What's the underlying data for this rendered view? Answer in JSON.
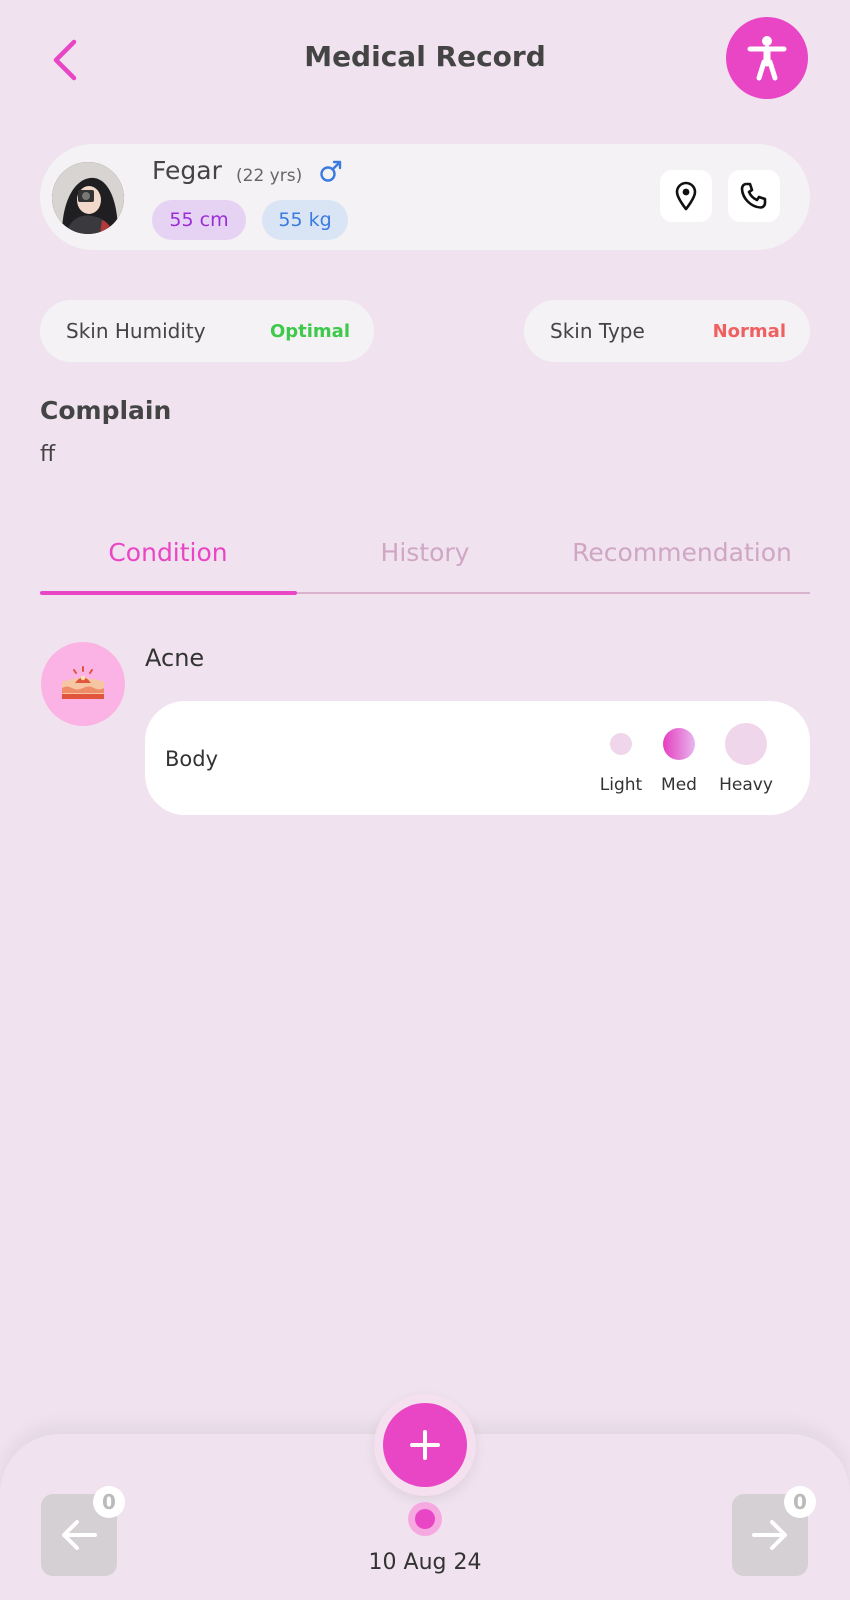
{
  "header": {
    "title": "Medical Record",
    "back_icon": "chevron-left-icon",
    "accessibility_icon": "accessibility-icon"
  },
  "patient": {
    "name": "Fegar",
    "age": "(22 yrs)",
    "gender_symbol": "♂",
    "height": "55 cm",
    "weight": "55 kg"
  },
  "skin": {
    "humidity_label": "Skin Humidity",
    "humidity_value": "Optimal",
    "type_label": "Skin Type",
    "type_value": "Normal"
  },
  "complain": {
    "heading": "Complain",
    "text": "ff"
  },
  "tabs": [
    {
      "label": "Condition",
      "active": true
    },
    {
      "label": "History",
      "active": false
    },
    {
      "label": "Recommendation",
      "active": false
    }
  ],
  "condition": {
    "name": "Acne",
    "area": "Body",
    "severity_options": [
      "Light",
      "Med",
      "Heavy"
    ],
    "selected_severity": "Med"
  },
  "footer": {
    "date": "10 Aug 24",
    "prev_count": "0",
    "next_count": "0"
  },
  "colors": {
    "accent": "#e946c5",
    "background": "#f0e3ef",
    "good": "#3ec94a",
    "warn": "#f06060"
  }
}
